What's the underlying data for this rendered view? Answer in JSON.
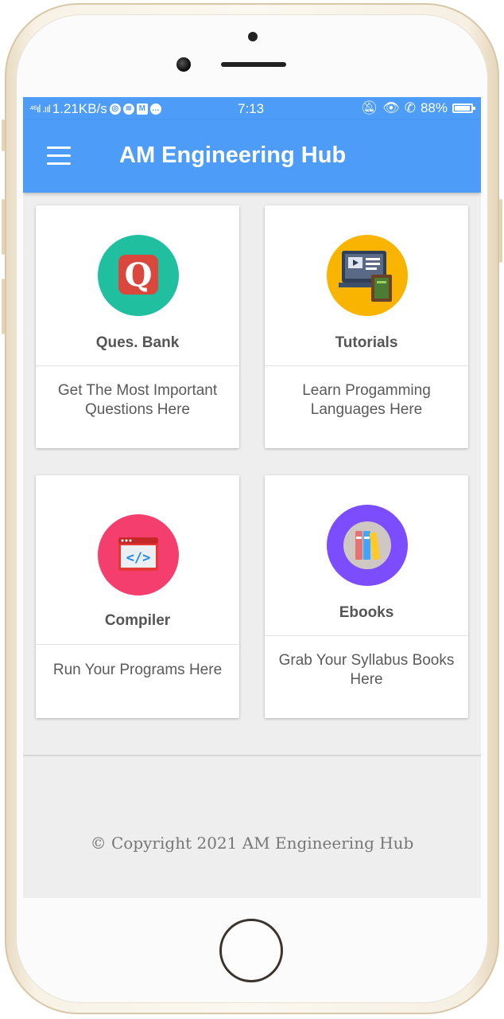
{
  "statusbar": {
    "signal": "⁴⁶ıl .ııl",
    "speed": "1.21KB/s",
    "time": "7:13",
    "battery": "88%"
  },
  "appbar": {
    "title": "AM Engineering Hub",
    "menu_icon": "hamburger-menu-icon"
  },
  "cards": [
    {
      "title": "Ques. Bank",
      "desc": "Get The Most Important Questions Here",
      "icon": "quora-q-icon",
      "color": "#1fbf9f"
    },
    {
      "title": "Tutorials",
      "desc": "Learn Progamming Languages Here",
      "icon": "video-tutorial-icon",
      "color": "#f8b400"
    },
    {
      "title": "Compiler",
      "desc": "Run Your Programs Here",
      "icon": "code-editor-icon",
      "color": "#f43f6e"
    },
    {
      "title": "Ebooks",
      "desc": "Grab Your Syllabus Books Here",
      "icon": "books-icon",
      "color": "#7c4dff"
    }
  ],
  "footer": {
    "copyright": "© Copyright 2021 AM Engineering Hub"
  },
  "colors": {
    "primary": "#4c9cf8",
    "background": "#eeeeee"
  }
}
